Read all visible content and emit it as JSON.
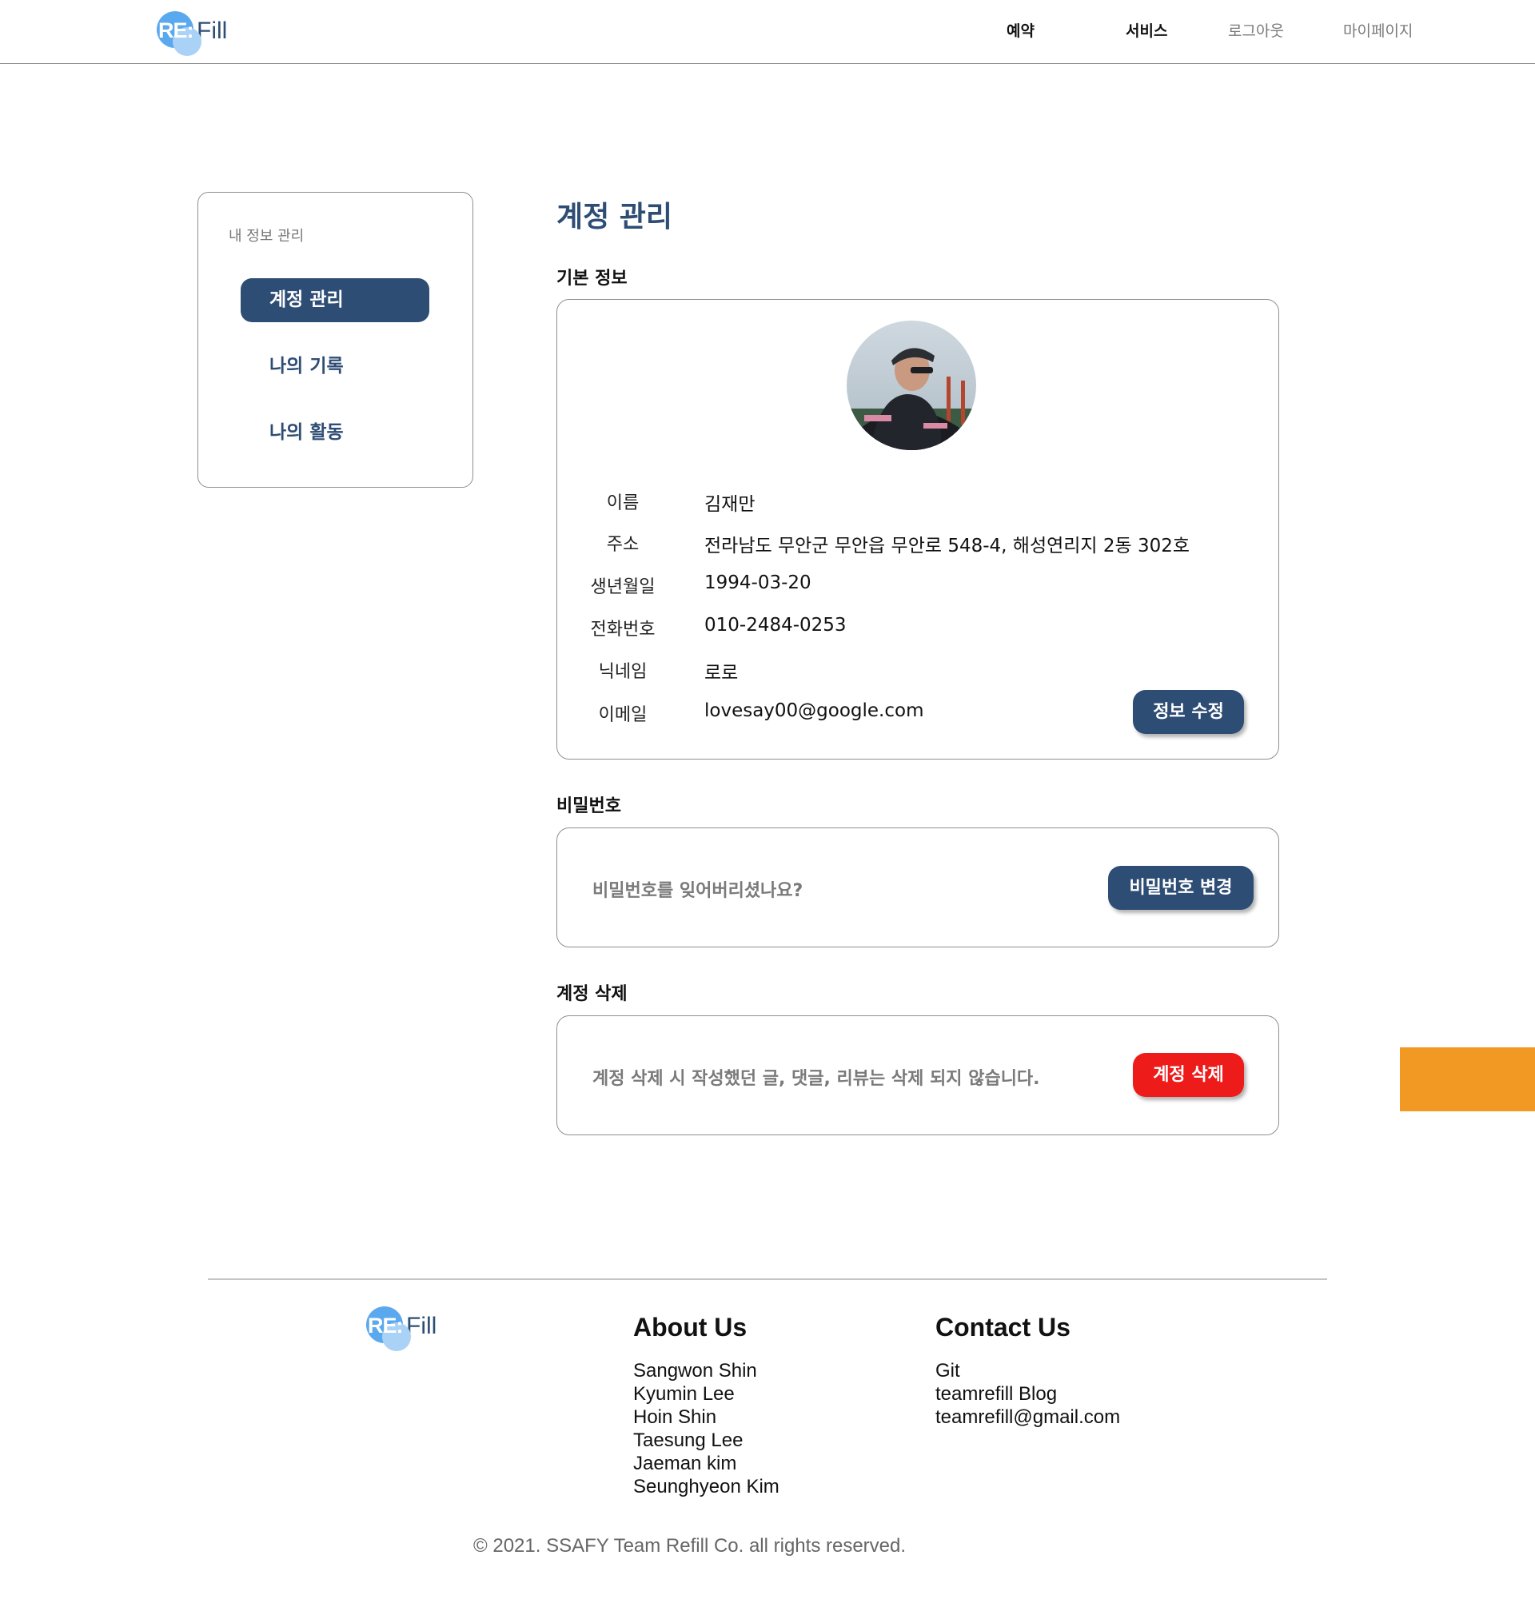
{
  "brand": {
    "logo_mark": "RE:",
    "logo_text": "Fill"
  },
  "nav": {
    "reserve": "예약",
    "service": "서비스",
    "logout": "로그아웃",
    "mypage": "마이페이지"
  },
  "sidebar": {
    "title": "내 정보 관리",
    "items": [
      {
        "label": "계정 관리",
        "active": true
      },
      {
        "label": "나의 기록",
        "active": false
      },
      {
        "label": "나의 활동",
        "active": false
      }
    ]
  },
  "main": {
    "title": "계정 관리",
    "basic": {
      "section_title": "기본 정보",
      "fields": [
        {
          "label": "이름",
          "value": "김재만"
        },
        {
          "label": "주소",
          "value": "전라남도 무안군 무안읍 무안로 548-4, 해성연리지 2동 302호"
        },
        {
          "label": "생년월일",
          "value": "1994-03-20"
        },
        {
          "label": "전화번호",
          "value": "010-2484-0253"
        },
        {
          "label": "닉네임",
          "value": "로로"
        },
        {
          "label": "이메일",
          "value": "lovesay00@google.com"
        }
      ],
      "edit_button": "정보 수정"
    },
    "password": {
      "section_title": "비밀번호",
      "text": "비밀번호를 잊어버리셨나요?",
      "button": "비밀번호 변경"
    },
    "delete": {
      "section_title": "계정 삭제",
      "text": "계정 삭제 시 작성했던 글, 댓글, 리뷰는 삭제 되지 않습니다.",
      "button": "계정 삭제"
    }
  },
  "footer": {
    "about_title": "About Us",
    "about": [
      "Sangwon Shin",
      "Kyumin Lee",
      "Hoin Shin",
      "Taesung Lee",
      "Jaeman kim",
      "Seunghyeon Kim"
    ],
    "contact_title": "Contact Us",
    "contact": [
      "Git",
      "teamrefill Blog",
      "teamrefill@gmail.com"
    ],
    "copyright": "© 2021. SSAFY Team Refill Co. all rights reserved."
  },
  "colors": {
    "primary": "#2e4d74",
    "danger": "#ee1b1b",
    "accent_orange": "#f29924",
    "logo_blue": "#5aa8ee"
  }
}
